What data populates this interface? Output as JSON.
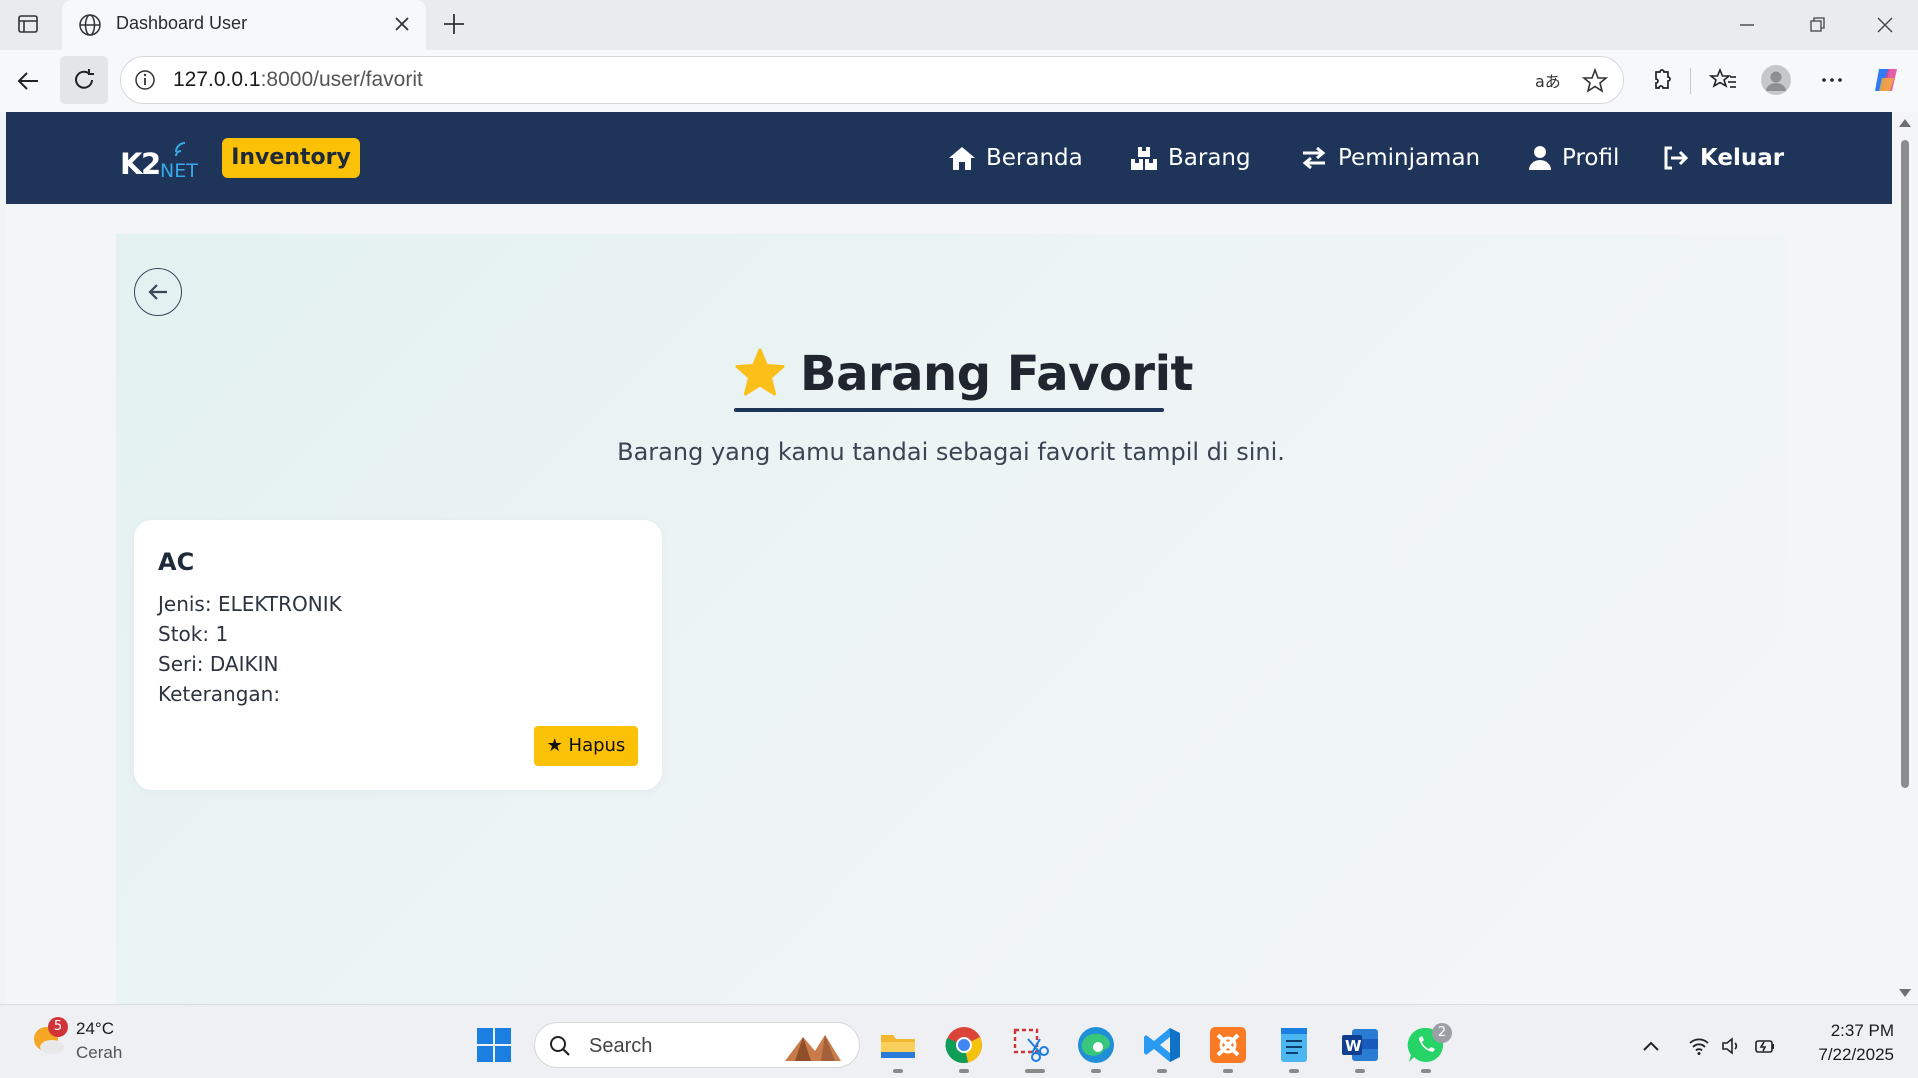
{
  "browser": {
    "tab_title": "Dashboard User",
    "url_host": "127.0.0.1",
    "url_path": ":8000/user/favorit"
  },
  "navbar": {
    "logo_text": "K2",
    "logo_sub": "NET",
    "badge": "Inventory",
    "items": [
      {
        "label": "Beranda",
        "icon": "home-icon"
      },
      {
        "label": "Barang",
        "icon": "boxes-icon"
      },
      {
        "label": "Peminjaman",
        "icon": "exchange-icon"
      },
      {
        "label": "Profil",
        "icon": "user-icon"
      },
      {
        "label": "Keluar",
        "icon": "logout-icon"
      }
    ]
  },
  "page": {
    "title": "Barang Favorit",
    "subtitle": "Barang yang kamu tandai sebagai favorit tampil di sini."
  },
  "favorites": [
    {
      "name": "AC",
      "jenis": "Jenis: ELEKTRONIK",
      "stok": "Stok: 1",
      "seri": "Seri: DAIKIN",
      "keterangan": "Keterangan:",
      "remove_label": "★ Hapus"
    }
  ],
  "taskbar": {
    "weather_badge": "5",
    "weather_temp": "24°C",
    "weather_desc": "Cerah",
    "search_label": "Search",
    "whatsapp_badge": "2",
    "time": "2:37 PM",
    "date": "7/22/2025"
  },
  "colors": {
    "navbar": "#1e3559",
    "accent": "#fbc107"
  }
}
